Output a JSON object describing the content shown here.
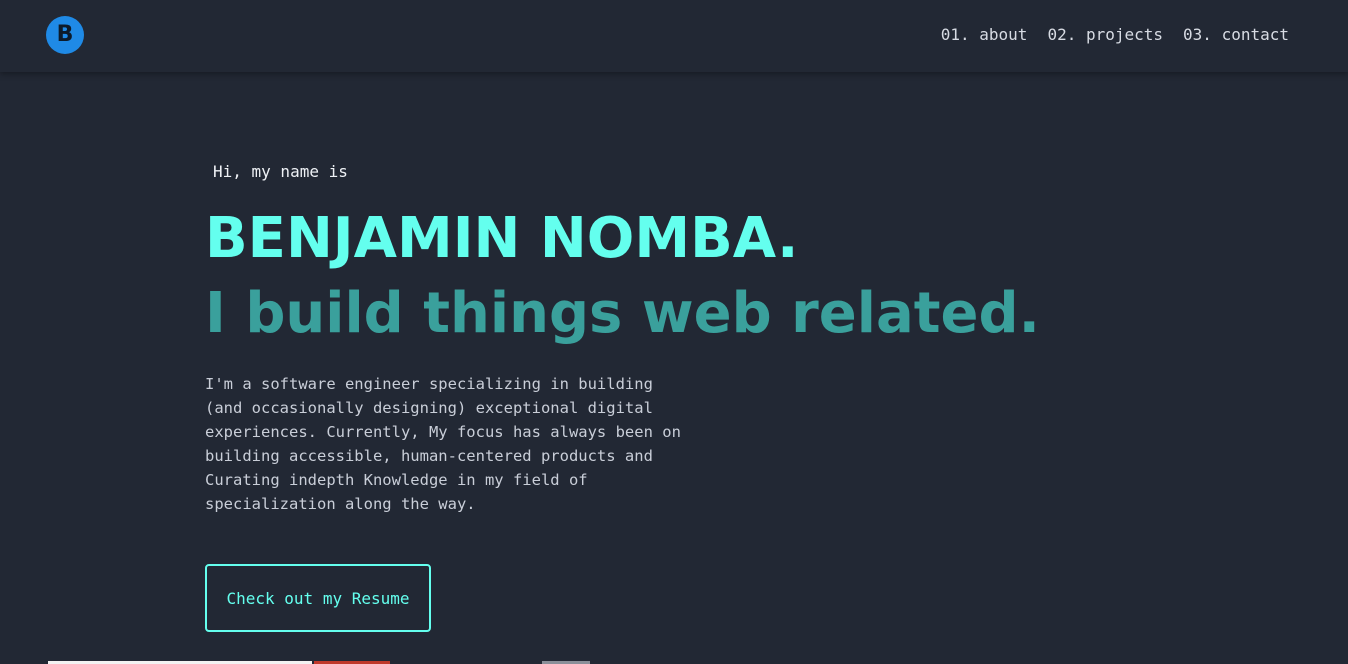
{
  "nav": {
    "logo_letter": "B",
    "links": [
      {
        "label": "01. about"
      },
      {
        "label": "02. projects"
      },
      {
        "label": "03. contact"
      }
    ]
  },
  "hero": {
    "greeting": "Hi, my name is",
    "name": "BENJAMIN NOMBA.",
    "tagline": "I build things web related.",
    "bio": "I'm a software engineer specializing in building (and occasionally designing) exceptional digital experiences. Currently, My focus has always been on building accessible, human-centered products and Curating indepth Knowledge in my field of specialization along the way.",
    "resume_label": "Check out my Resume"
  },
  "colors": {
    "background": "#222834",
    "accent": "#64ffee",
    "accent_dim": "#3aa09c",
    "logo": "#1f8ae6"
  }
}
